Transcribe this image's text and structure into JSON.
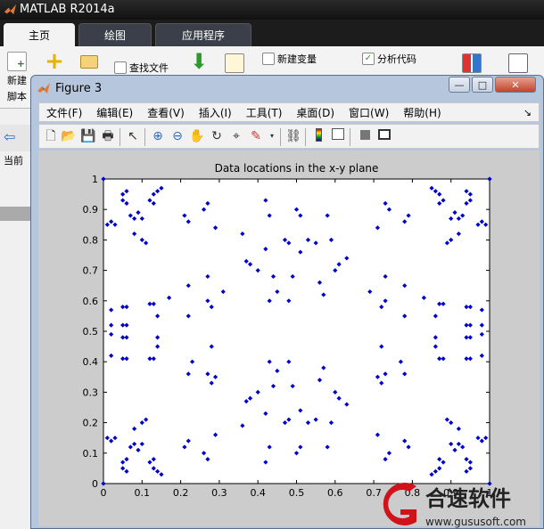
{
  "app": {
    "title": "MATLAB R2014a"
  },
  "ribbon_tabs": [
    {
      "label": "主页",
      "active": true
    },
    {
      "label": "绘图",
      "active": false
    },
    {
      "label": "应用程序",
      "active": false
    }
  ],
  "ribbon": {
    "new_script_line1": "新建",
    "new_script_line2": "脚本",
    "find_files": "查找文件",
    "new_variable": "新建变量",
    "analyze_code": "分析代码"
  },
  "left_pane": {
    "current_folder_label": "当前"
  },
  "figure": {
    "title": "Figure 3",
    "menus": [
      "文件(F)",
      "编辑(E)",
      "查看(V)",
      "插入(I)",
      "工具(T)",
      "桌面(D)",
      "窗口(W)",
      "帮助(H)"
    ],
    "menu_overflow": "↘",
    "toolbar_icons": [
      "new-figure-icon",
      "open-file-icon",
      "save-icon",
      "print-icon",
      "pointer-icon",
      "zoom-in-icon",
      "zoom-out-icon",
      "pan-icon",
      "rotate-3d-icon",
      "data-cursor-icon",
      "brush-icon",
      "link-plot-icon",
      "colorbar-icon",
      "legend-icon",
      "hide-plot-tools-icon",
      "show-plot-tools-icon"
    ]
  },
  "watermark": {
    "brand": "合速软件",
    "url": "www.gususoft.com"
  },
  "colors": {
    "marker": "#0000cc",
    "axes_bg": "#ffffff",
    "figure_bg": "#cccccc"
  },
  "chart_data": {
    "type": "scatter",
    "title": "Data locations in the x-y plane",
    "xlabel": "",
    "ylabel": "",
    "xlim": [
      0,
      1
    ],
    "ylim": [
      0,
      1
    ],
    "xticks": [
      "0",
      "0.1",
      "0.2",
      "0.3",
      "0.4",
      "0.5",
      "0.6",
      "0.7",
      "0.8",
      "0.9",
      "1"
    ],
    "yticks": [
      "0",
      "0.1",
      "0.2",
      "0.3",
      "0.4",
      "0.5",
      "0.6",
      "0.7",
      "0.8",
      "0.9",
      "1"
    ],
    "grid": false,
    "marker": "diamond",
    "corner_points": [
      [
        0,
        0
      ],
      [
        0,
        1
      ],
      [
        1,
        0
      ],
      [
        1,
        1
      ]
    ],
    "points": [
      [
        0.01,
        0.85
      ],
      [
        0.02,
        0.86
      ],
      [
        0.03,
        0.85
      ],
      [
        0.05,
        0.95
      ],
      [
        0.06,
        0.96
      ],
      [
        0.05,
        0.93
      ],
      [
        0.06,
        0.92
      ],
      [
        0.07,
        0.88
      ],
      [
        0.08,
        0.87
      ],
      [
        0.09,
        0.89
      ],
      [
        0.1,
        0.87
      ],
      [
        0.08,
        0.82
      ],
      [
        0.1,
        0.8
      ],
      [
        0.11,
        0.79
      ],
      [
        0.12,
        0.93
      ],
      [
        0.13,
        0.95
      ],
      [
        0.14,
        0.96
      ],
      [
        0.15,
        0.97
      ],
      [
        0.13,
        0.92
      ],
      [
        0.21,
        0.88
      ],
      [
        0.22,
        0.86
      ],
      [
        0.26,
        0.9
      ],
      [
        0.27,
        0.92
      ],
      [
        0.29,
        0.84
      ],
      [
        0.02,
        0.57
      ],
      [
        0.02,
        0.52
      ],
      [
        0.02,
        0.49
      ],
      [
        0.02,
        0.42
      ],
      [
        0.05,
        0.58
      ],
      [
        0.06,
        0.58
      ],
      [
        0.05,
        0.52
      ],
      [
        0.06,
        0.52
      ],
      [
        0.05,
        0.48
      ],
      [
        0.06,
        0.48
      ],
      [
        0.05,
        0.41
      ],
      [
        0.06,
        0.41
      ],
      [
        0.12,
        0.59
      ],
      [
        0.13,
        0.59
      ],
      [
        0.14,
        0.55
      ],
      [
        0.14,
        0.48
      ],
      [
        0.12,
        0.41
      ],
      [
        0.13,
        0.41
      ],
      [
        0.14,
        0.45
      ],
      [
        0.17,
        0.61
      ],
      [
        0.22,
        0.65
      ],
      [
        0.22,
        0.55
      ],
      [
        0.23,
        0.4
      ],
      [
        0.27,
        0.68
      ],
      [
        0.27,
        0.6
      ],
      [
        0.28,
        0.58
      ],
      [
        0.28,
        0.45
      ],
      [
        0.31,
        0.63
      ],
      [
        0.27,
        0.36
      ],
      [
        0.28,
        0.33
      ],
      [
        0.29,
        0.35
      ],
      [
        0.22,
        0.36
      ],
      [
        0.01,
        0.15
      ],
      [
        0.02,
        0.14
      ],
      [
        0.03,
        0.15
      ],
      [
        0.05,
        0.05
      ],
      [
        0.06,
        0.04
      ],
      [
        0.05,
        0.07
      ],
      [
        0.06,
        0.08
      ],
      [
        0.07,
        0.12
      ],
      [
        0.08,
        0.13
      ],
      [
        0.09,
        0.11
      ],
      [
        0.1,
        0.13
      ],
      [
        0.08,
        0.18
      ],
      [
        0.1,
        0.2
      ],
      [
        0.11,
        0.21
      ],
      [
        0.12,
        0.07
      ],
      [
        0.13,
        0.05
      ],
      [
        0.14,
        0.04
      ],
      [
        0.15,
        0.03
      ],
      [
        0.13,
        0.08
      ],
      [
        0.21,
        0.12
      ],
      [
        0.22,
        0.14
      ],
      [
        0.26,
        0.1
      ],
      [
        0.27,
        0.08
      ],
      [
        0.29,
        0.16
      ],
      [
        0.36,
        0.82
      ],
      [
        0.37,
        0.73
      ],
      [
        0.38,
        0.72
      ],
      [
        0.4,
        0.7
      ],
      [
        0.42,
        0.93
      ],
      [
        0.43,
        0.88
      ],
      [
        0.43,
        0.6
      ],
      [
        0.42,
        0.77
      ],
      [
        0.44,
        0.68
      ],
      [
        0.45,
        0.63
      ],
      [
        0.47,
        0.8
      ],
      [
        0.48,
        0.79
      ],
      [
        0.48,
        0.6
      ],
      [
        0.49,
        0.68
      ],
      [
        0.5,
        0.9
      ],
      [
        0.51,
        0.88
      ],
      [
        0.51,
        0.76
      ],
      [
        0.53,
        0.8
      ],
      [
        0.55,
        0.79
      ],
      [
        0.56,
        0.66
      ],
      [
        0.57,
        0.62
      ],
      [
        0.58,
        0.88
      ],
      [
        0.59,
        0.8
      ],
      [
        0.6,
        0.7
      ],
      [
        0.61,
        0.72
      ],
      [
        0.63,
        0.74
      ],
      [
        0.36,
        0.19
      ],
      [
        0.37,
        0.27
      ],
      [
        0.38,
        0.28
      ],
      [
        0.4,
        0.3
      ],
      [
        0.42,
        0.07
      ],
      [
        0.43,
        0.12
      ],
      [
        0.43,
        0.4
      ],
      [
        0.42,
        0.23
      ],
      [
        0.44,
        0.32
      ],
      [
        0.45,
        0.37
      ],
      [
        0.47,
        0.2
      ],
      [
        0.48,
        0.21
      ],
      [
        0.48,
        0.4
      ],
      [
        0.49,
        0.32
      ],
      [
        0.5,
        0.1
      ],
      [
        0.51,
        0.12
      ],
      [
        0.51,
        0.24
      ],
      [
        0.53,
        0.2
      ],
      [
        0.55,
        0.21
      ],
      [
        0.56,
        0.34
      ],
      [
        0.57,
        0.38
      ],
      [
        0.58,
        0.12
      ],
      [
        0.59,
        0.2
      ],
      [
        0.6,
        0.3
      ],
      [
        0.61,
        0.28
      ],
      [
        0.63,
        0.26
      ],
      [
        0.99,
        0.85
      ],
      [
        0.98,
        0.86
      ],
      [
        0.97,
        0.85
      ],
      [
        0.95,
        0.95
      ],
      [
        0.94,
        0.96
      ],
      [
        0.95,
        0.93
      ],
      [
        0.94,
        0.92
      ],
      [
        0.93,
        0.88
      ],
      [
        0.92,
        0.87
      ],
      [
        0.91,
        0.89
      ],
      [
        0.9,
        0.87
      ],
      [
        0.92,
        0.82
      ],
      [
        0.9,
        0.8
      ],
      [
        0.89,
        0.79
      ],
      [
        0.88,
        0.93
      ],
      [
        0.87,
        0.95
      ],
      [
        0.86,
        0.96
      ],
      [
        0.85,
        0.97
      ],
      [
        0.87,
        0.92
      ],
      [
        0.79,
        0.88
      ],
      [
        0.78,
        0.86
      ],
      [
        0.74,
        0.9
      ],
      [
        0.73,
        0.92
      ],
      [
        0.71,
        0.84
      ],
      [
        0.98,
        0.57
      ],
      [
        0.98,
        0.52
      ],
      [
        0.98,
        0.49
      ],
      [
        0.98,
        0.42
      ],
      [
        0.95,
        0.58
      ],
      [
        0.94,
        0.58
      ],
      [
        0.95,
        0.52
      ],
      [
        0.94,
        0.52
      ],
      [
        0.95,
        0.48
      ],
      [
        0.94,
        0.48
      ],
      [
        0.95,
        0.41
      ],
      [
        0.94,
        0.41
      ],
      [
        0.88,
        0.59
      ],
      [
        0.87,
        0.59
      ],
      [
        0.86,
        0.55
      ],
      [
        0.86,
        0.48
      ],
      [
        0.88,
        0.41
      ],
      [
        0.87,
        0.41
      ],
      [
        0.86,
        0.45
      ],
      [
        0.83,
        0.61
      ],
      [
        0.78,
        0.65
      ],
      [
        0.78,
        0.55
      ],
      [
        0.77,
        0.4
      ],
      [
        0.73,
        0.68
      ],
      [
        0.73,
        0.6
      ],
      [
        0.72,
        0.58
      ],
      [
        0.72,
        0.45
      ],
      [
        0.69,
        0.63
      ],
      [
        0.73,
        0.36
      ],
      [
        0.72,
        0.33
      ],
      [
        0.71,
        0.35
      ],
      [
        0.78,
        0.36
      ],
      [
        0.99,
        0.15
      ],
      [
        0.98,
        0.14
      ],
      [
        0.97,
        0.15
      ],
      [
        0.95,
        0.05
      ],
      [
        0.94,
        0.04
      ],
      [
        0.95,
        0.07
      ],
      [
        0.94,
        0.08
      ],
      [
        0.93,
        0.12
      ],
      [
        0.92,
        0.13
      ],
      [
        0.91,
        0.11
      ],
      [
        0.9,
        0.13
      ],
      [
        0.92,
        0.18
      ],
      [
        0.9,
        0.2
      ],
      [
        0.89,
        0.21
      ],
      [
        0.88,
        0.07
      ],
      [
        0.87,
        0.05
      ],
      [
        0.86,
        0.04
      ],
      [
        0.85,
        0.03
      ],
      [
        0.87,
        0.08
      ],
      [
        0.79,
        0.12
      ],
      [
        0.78,
        0.14
      ],
      [
        0.74,
        0.1
      ],
      [
        0.73,
        0.08
      ],
      [
        0.71,
        0.16
      ]
    ]
  }
}
